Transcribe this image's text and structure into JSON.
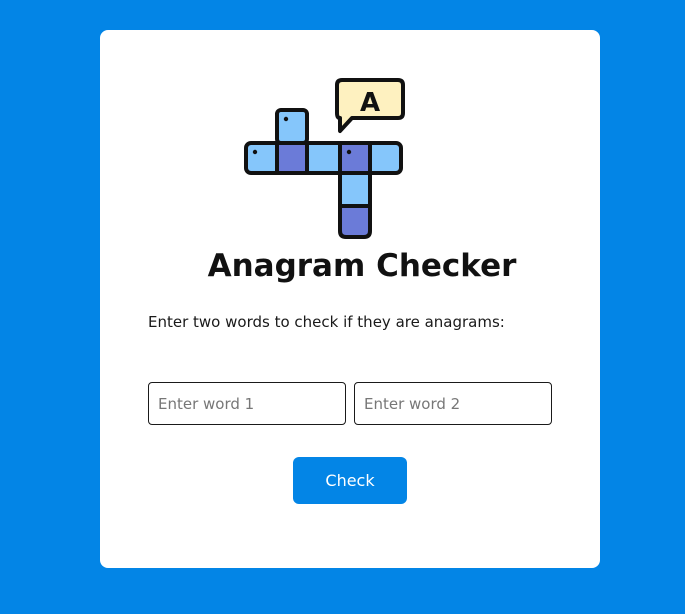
{
  "app": {
    "title": "Anagram Checker",
    "instructions": "Enter two words to check if they are anagrams:",
    "logo_icon": "crossword-puzzle-icon",
    "logo_letter": "A"
  },
  "form": {
    "word1": {
      "value": "",
      "placeholder": "Enter word 1"
    },
    "word2": {
      "value": "",
      "placeholder": "Enter word 2"
    },
    "check_label": "Check"
  },
  "colors": {
    "background": "#0385e6",
    "card": "#ffffff",
    "button": "#0385e6",
    "tile_light": "#85c6fb",
    "tile_dark": "#6b7bd8",
    "bubble": "#fef1c0"
  }
}
